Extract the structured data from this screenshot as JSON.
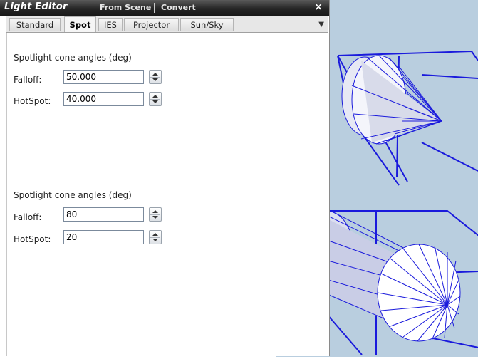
{
  "window": {
    "title": "Light Editor",
    "menu_from_scene": "From Scene",
    "menu_convert": "Convert",
    "close_glyph": "×"
  },
  "tabs": [
    {
      "label": "Standard",
      "active": false
    },
    {
      "label": "Spot",
      "active": true
    },
    {
      "label": "IES",
      "active": false
    },
    {
      "label": "Projector",
      "active": false
    },
    {
      "label": "Sun/Sky",
      "active": false
    }
  ],
  "tab_menu_glyph": "▼",
  "panels": [
    {
      "section_title": "Spotlight cone angles (deg)",
      "falloff_label": "Falloff:",
      "falloff_value": "50.000",
      "hotspot_label": "HotSpot:",
      "hotspot_value": "40.000"
    },
    {
      "section_title": "Spotlight cone angles (deg)",
      "falloff_label": "Falloff:",
      "falloff_value": "80",
      "hotspot_label": "HotSpot:",
      "hotspot_value": "20"
    }
  ],
  "colors": {
    "viewport_bg": "#b9cedf",
    "wire_blue": "#1a1adc",
    "cone_fill": "#ffffff"
  }
}
